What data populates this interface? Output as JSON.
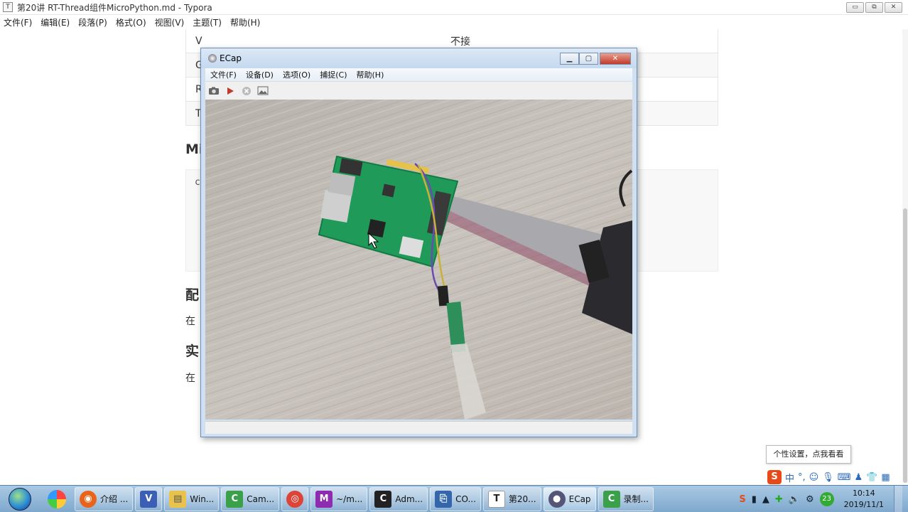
{
  "typora": {
    "title": "第20讲 RT-Thread组件MicroPython.md - Typora",
    "app_icon": "T",
    "window_controls": {
      "minimize": "▭",
      "restore": "⧉",
      "close": "✕"
    },
    "menu": [
      "文件(F)",
      "编辑(E)",
      "段落(P)",
      "格式(O)",
      "视图(V)",
      "主题(T)",
      "帮助(H)"
    ],
    "table_rows": [
      {
        "c1": "V",
        "c2": "不接"
      },
      {
        "c1": "G",
        "c2": ""
      },
      {
        "c1": "R",
        "c2": ""
      },
      {
        "c1": "T",
        "c2": ""
      }
    ],
    "heading_1": "Mi",
    "code_fragment": "c",
    "heading_2": "配",
    "text_1": "在",
    "heading_3": "实",
    "text_2": "在"
  },
  "ecap": {
    "title": "ECap",
    "window_controls": {
      "minimize": "▁",
      "maximize": "▢",
      "close": "✕"
    },
    "menu": [
      "文件(F)",
      "设备(D)",
      "选项(O)",
      "捕捉(C)",
      "帮助(H)"
    ],
    "toolbar": {
      "snapshot_icon": "camera-icon",
      "play_icon": "play-icon",
      "stop_icon": "stop-icon",
      "image_icon": "image-icon"
    }
  },
  "tooltip": "个性设置，点我看看",
  "ime": {
    "logo": "S",
    "lang": "中"
  },
  "taskbar": {
    "tasks": [
      {
        "label": "介绍 ...",
        "color": "#e8641b",
        "glyph": "◉"
      },
      {
        "label": "",
        "color": "#3b5fb5",
        "glyph": "V"
      },
      {
        "label": "Win...",
        "color": "#e8c24a",
        "glyph": "▤"
      },
      {
        "label": "Cam...",
        "color": "#3aa04a",
        "glyph": "C"
      },
      {
        "label": "",
        "color": "#db4437",
        "glyph": "◎"
      },
      {
        "label": "~/m...",
        "color": "#8e2bb0",
        "glyph": "M"
      },
      {
        "label": "Adm...",
        "color": "#222222",
        "glyph": "C"
      },
      {
        "label": "CO...",
        "color": "#3366aa",
        "glyph": "⎘"
      },
      {
        "label": "第20...",
        "color": "#ffffff",
        "glyph": "T"
      },
      {
        "label": "ECap",
        "color": "#555577",
        "glyph": "●"
      },
      {
        "label": "录制...",
        "color": "#3aa04a",
        "glyph": "C"
      }
    ],
    "tray_badge": "23",
    "clock_time": "10:14",
    "clock_date": "2019/11/1"
  }
}
